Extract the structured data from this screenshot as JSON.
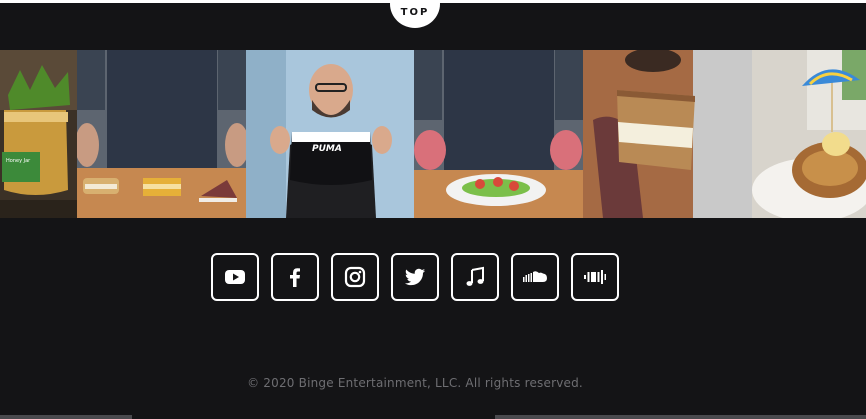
{
  "top_button": {
    "label": "TOP"
  },
  "photo_strip": {
    "items": [
      {
        "name": "honey-jar-photo",
        "caption": "Honey Jar"
      },
      {
        "name": "sandwich-cookies-photo",
        "caption": ""
      },
      {
        "name": "chef-puma-shirt-photo",
        "caption": "PUMA"
      },
      {
        "name": "chef-salad-plate-photo",
        "caption": ""
      },
      {
        "name": "cake-slice-photo",
        "caption": ""
      },
      {
        "name": "cinnamon-roll-umbrella-photo",
        "caption": ""
      }
    ]
  },
  "social": {
    "items": [
      {
        "name": "youtube-icon",
        "label": "YouTube"
      },
      {
        "name": "facebook-icon",
        "label": "Facebook"
      },
      {
        "name": "instagram-icon",
        "label": "Instagram"
      },
      {
        "name": "twitter-icon",
        "label": "Twitter"
      },
      {
        "name": "music-note-icon",
        "label": "Music"
      },
      {
        "name": "soundcloud-icon",
        "label": "SoundCloud"
      },
      {
        "name": "podcast-icon",
        "label": "Podcast"
      }
    ]
  },
  "footer": {
    "copyright": "© 2020 Binge Entertainment, LLC. All rights reserved."
  },
  "colors": {
    "background": "#141416",
    "text_muted": "#6e6e72",
    "icon": "#ffffff"
  }
}
